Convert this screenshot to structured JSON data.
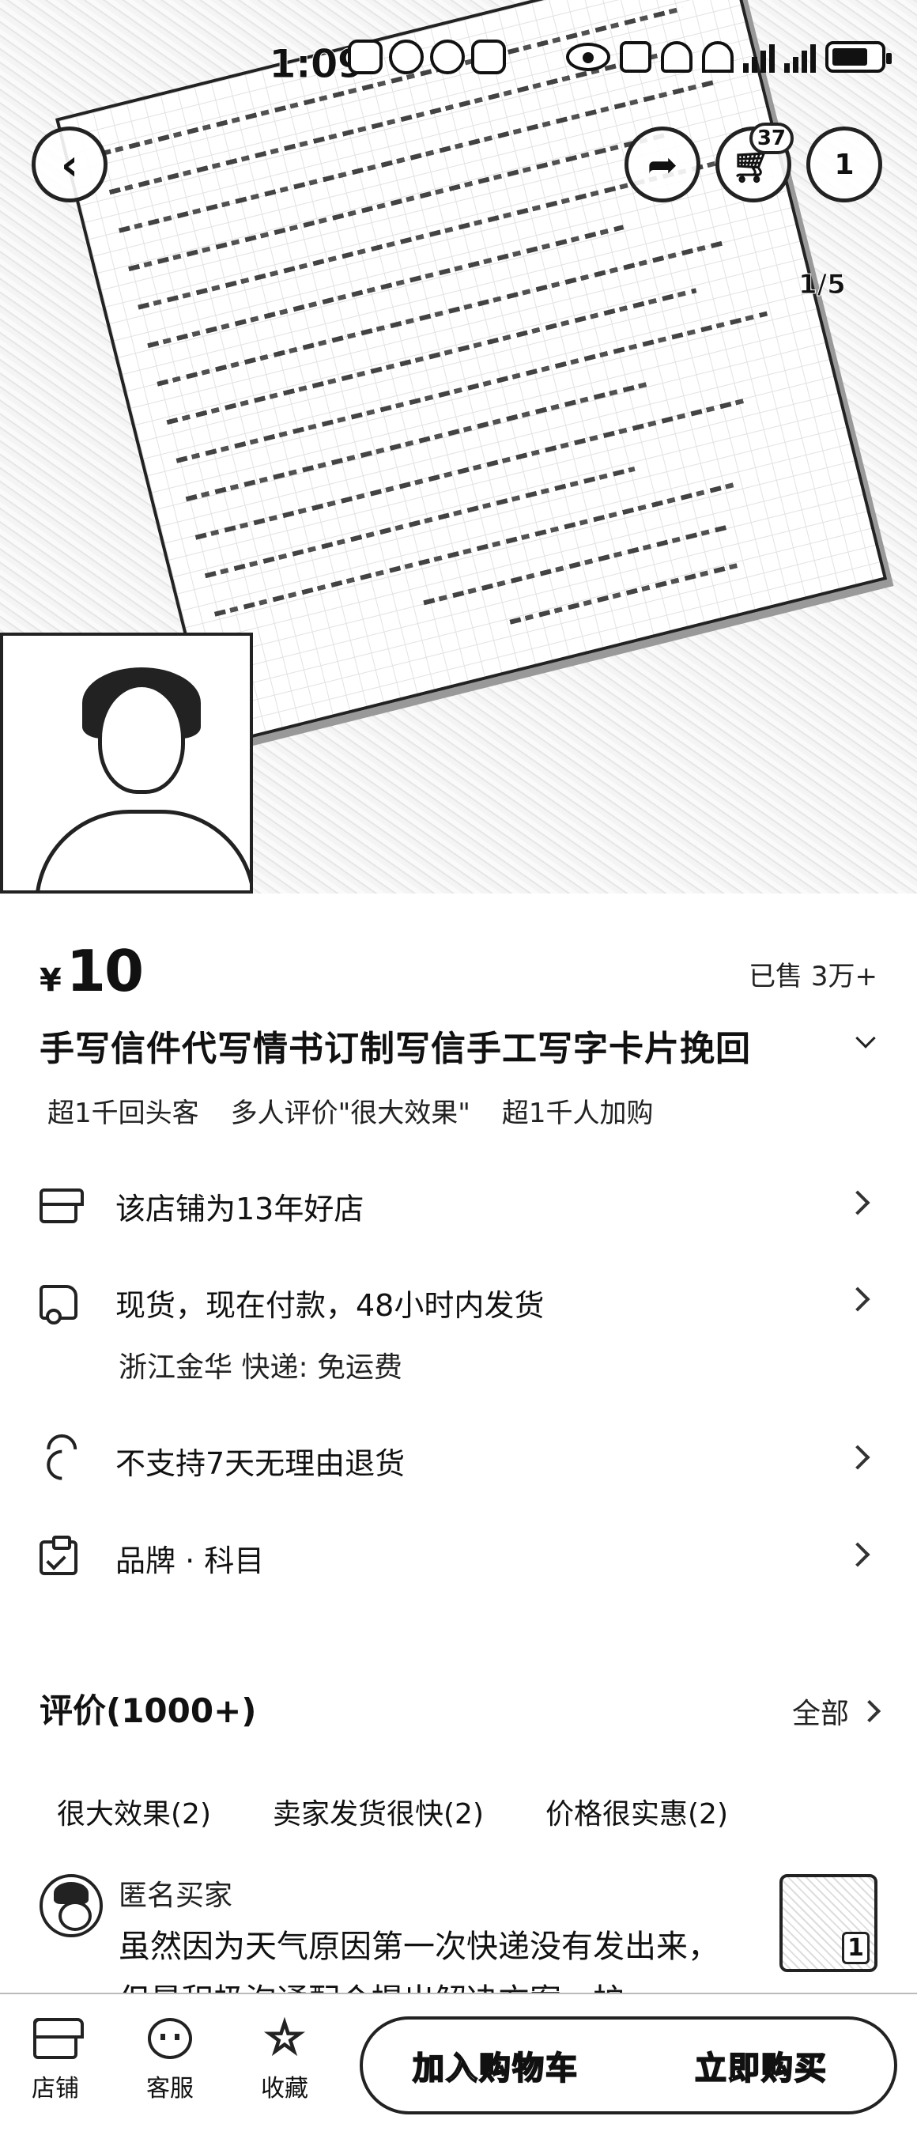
{
  "status_bar": {
    "time": "1:09",
    "network": "5G 4G"
  },
  "hero": {
    "page_indicator": "1/5",
    "cart_count": "37",
    "more_label": "1"
  },
  "product": {
    "price_symbol": "¥",
    "price": "10",
    "sold": "已售 3万+",
    "title": "手写信件代写情书订制写信手工写字卡片挽回",
    "tags": [
      "超1千回头客",
      "多人评价\"很大效果\"",
      "超1千人加购"
    ]
  },
  "info": {
    "shop": "该店铺为13年好店",
    "shipping": "现货，现在付款，48小时内发货",
    "shipping_sub": "浙江金华  快递: 免运费",
    "returns": "不支持7天无理由退货",
    "brand": "品牌 · 科目"
  },
  "reviews": {
    "title": "评价(1000+)",
    "all_label": "全部",
    "tags": [
      "很大效果(2)",
      "卖家发货很快(2)",
      "价格很实惠(2)"
    ],
    "first": {
      "user": "匿名买家",
      "text": "虽然因为天气原因第一次快递没有发出来，但是积极沟通配合提出解决方案，护",
      "thumb_label": "1"
    }
  },
  "bottom_bar": {
    "shop_label": "店铺",
    "service_label": "客服",
    "fav_label": "收藏",
    "add_cart_label": "加入购物车",
    "buy_now_label": "立即购买"
  }
}
